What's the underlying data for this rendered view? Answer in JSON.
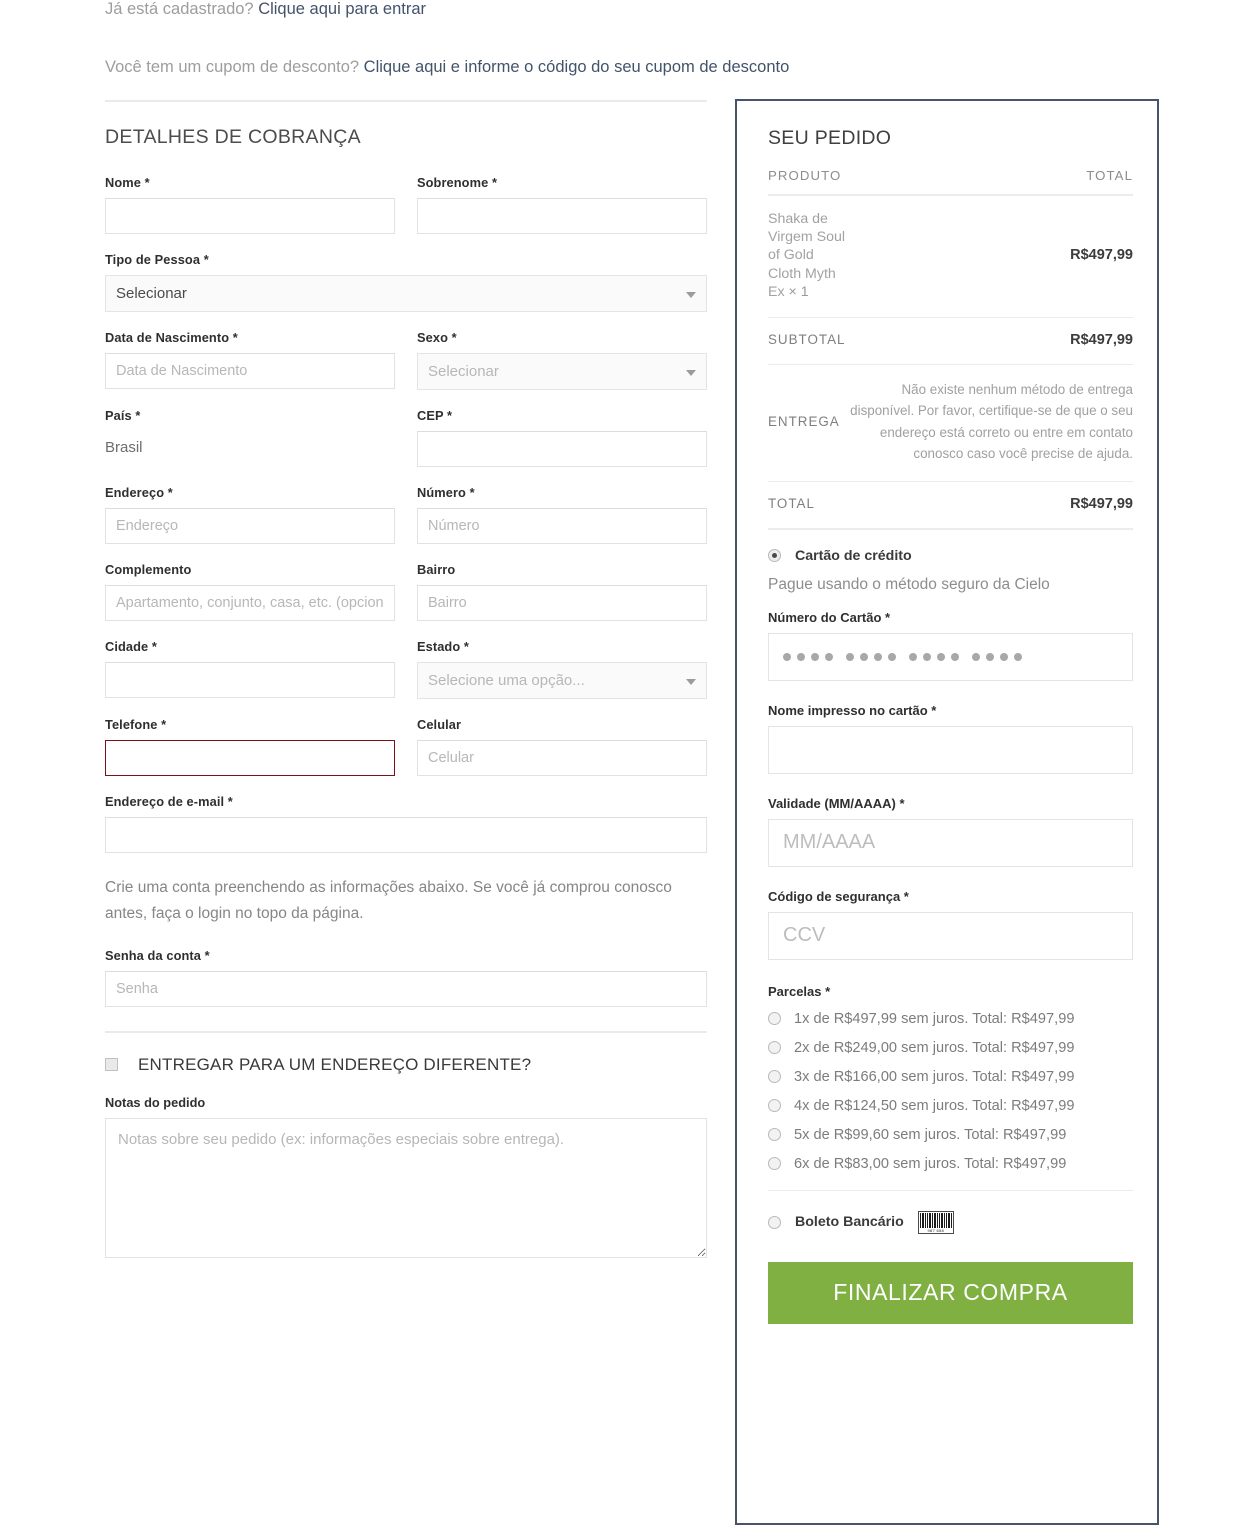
{
  "notices": {
    "login_prefix": "Já está cadastrado? ",
    "login_link": "Clique aqui para entrar",
    "coupon_prefix": "Você tem um cupom de desconto? ",
    "coupon_link": "Clique aqui e informe o código do seu cupom de desconto"
  },
  "billing": {
    "title": "DETALHES DE COBRANÇA",
    "fields": {
      "nome_label": "Nome *",
      "nome_value": "",
      "sobrenome_label": "Sobrenome *",
      "sobrenome_value": "",
      "tipo_pessoa_label": "Tipo de Pessoa *",
      "tipo_pessoa_value": "Selecionar",
      "nascimento_label": "Data de Nascimento *",
      "nascimento_placeholder": "Data de Nascimento",
      "sexo_label": "Sexo *",
      "sexo_value": "Selecionar",
      "pais_label": "País *",
      "pais_value": "Brasil",
      "cep_label": "CEP *",
      "cep_value": "",
      "endereco_label": "Endereço *",
      "endereco_placeholder": "Endereço",
      "numero_label": "Número *",
      "numero_placeholder": "Número",
      "complemento_label": "Complemento",
      "complemento_placeholder": "Apartamento, conjunto, casa, etc. (opcional)",
      "bairro_label": "Bairro",
      "bairro_placeholder": "Bairro",
      "cidade_label": "Cidade *",
      "cidade_value": "",
      "estado_label": "Estado *",
      "estado_value": "Selecione uma opção...",
      "telefone_label": "Telefone *",
      "telefone_value": "",
      "celular_label": "Celular",
      "celular_placeholder": "Celular",
      "email_label": "Endereço de e-mail *",
      "email_value": ""
    },
    "account_help": "Crie uma conta preenchendo as informações abaixo. Se você já comprou conosco antes, faça o login no topo da página.",
    "senha_label": "Senha da conta *",
    "senha_placeholder": "Senha",
    "ship_different_label": "ENTREGAR PARA UM ENDEREÇO DIFERENTE?",
    "notas_label": "Notas do pedido",
    "notas_placeholder": "Notas sobre seu pedido (ex: informações especiais sobre entrega)."
  },
  "order": {
    "title": "SEU PEDIDO",
    "col_product": "PRODUTO",
    "col_total": "TOTAL",
    "item_name": "Shaka de Virgem Soul of Gold Cloth Myth Ex",
    "item_qty": "× 1",
    "item_total": "R$497,99",
    "subtotal_label": "SUBTOTAL",
    "subtotal_value": "R$497,99",
    "entrega_label": "ENTREGA",
    "entrega_message": "Não existe nenhum método de entrega disponível. Por favor, certifique-se de que o seu endereço está correto ou entre em contato conosco caso você precise de ajuda.",
    "total_label": "TOTAL",
    "total_value": "R$497,99"
  },
  "payment": {
    "credit_label": "Cartão de crédito",
    "credit_sub": "Pague usando o método seguro da Cielo",
    "card_number_label": "Número do Cartão *",
    "card_name_label": "Nome impresso no cartão *",
    "card_name_value": "",
    "validity_label": "Validade (MM/AAAA) *",
    "validity_placeholder": "MM/AAAA",
    "ccv_label": "Código de segurança *",
    "ccv_placeholder": "CCV",
    "parcelas_label": "Parcelas *",
    "parcelas": [
      "1x de R$497,99 sem juros. Total: R$497,99",
      "2x de R$249,00 sem juros. Total: R$497,99",
      "3x de R$166,00 sem juros. Total: R$497,99",
      "4x de R$124,50 sem juros. Total: R$497,99",
      "5x de R$99,60 sem juros. Total: R$497,99",
      "6x de R$83,00 sem juros. Total: R$497,99"
    ],
    "boleto_label": "Boleto Bancário",
    "boleto_barcode_number": "987 658",
    "checkout_button": "FINALIZAR COMPRA"
  },
  "colors": {
    "panel_border": "#46536a",
    "checkout_green": "#7fb041",
    "error_border": "#7b1018",
    "link": "#43536a"
  }
}
